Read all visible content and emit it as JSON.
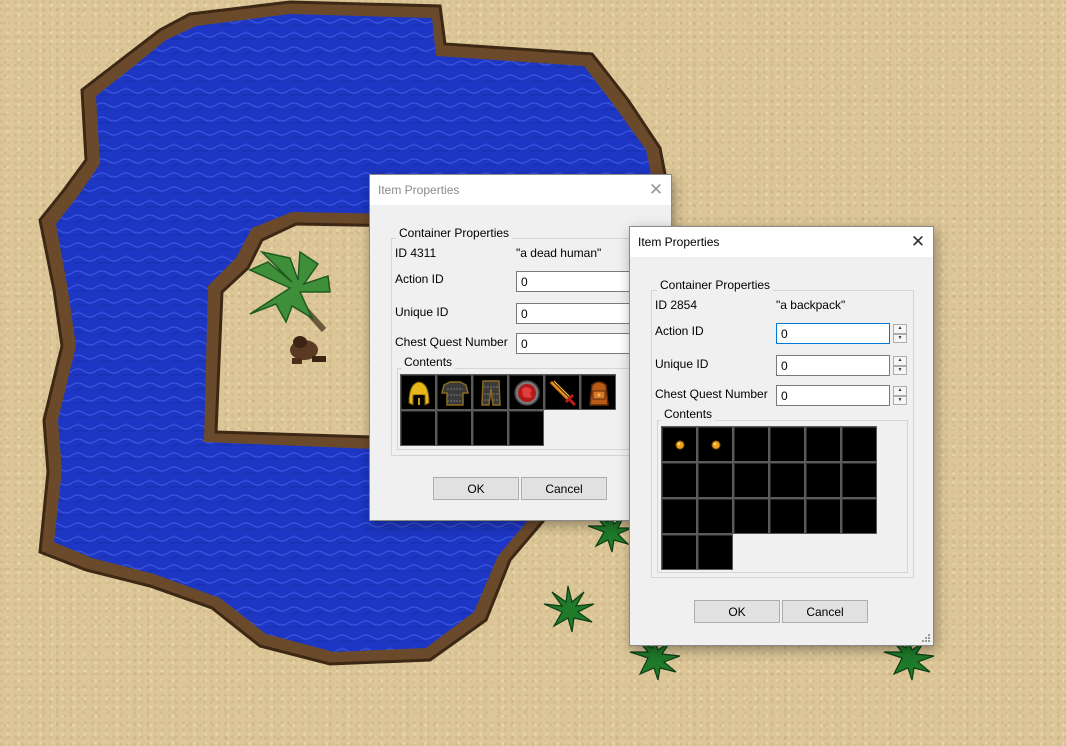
{
  "dialog1": {
    "title": "Item Properties",
    "group_label": "Container Properties",
    "id_label": "ID 4311",
    "item_name": "\"a dead human\"",
    "action_id_label": "Action ID",
    "action_id_value": "0",
    "unique_id_label": "Unique ID",
    "unique_id_value": "0",
    "chest_quest_label": "Chest Quest Number",
    "chest_quest_value": "0",
    "contents_label": "Contents",
    "contents": [
      "golden-helmet-icon",
      "chain-armor-icon",
      "chain-legs-icon",
      "round-shield-icon",
      "fire-sword-icon",
      "backpack-icon",
      "",
      "",
      "",
      ""
    ],
    "ok_label": "OK",
    "cancel_label": "Cancel"
  },
  "dialog2": {
    "title": "Item Properties",
    "group_label": "Container Properties",
    "id_label": "ID 2854",
    "item_name": "\"a backpack\"",
    "action_id_label": "Action ID",
    "action_id_value": "0",
    "unique_id_label": "Unique ID",
    "unique_id_value": "0",
    "chest_quest_label": "Chest Quest Number",
    "chest_quest_value": "0",
    "contents_label": "Contents",
    "contents": [
      "gold-coin-icon",
      "gold-coin-icon",
      "",
      "",
      "",
      "",
      "",
      "",
      "",
      "",
      "",
      "",
      "",
      "",
      "",
      "",
      "",
      "",
      "",
      ""
    ],
    "ok_label": "OK",
    "cancel_label": "Cancel"
  },
  "colors": {
    "sand": "#dcc698",
    "water": "#1d36c4",
    "shore": "#6b4a2b",
    "dialog_bg": "#f0f0f0",
    "focus_border": "#0078d7"
  }
}
